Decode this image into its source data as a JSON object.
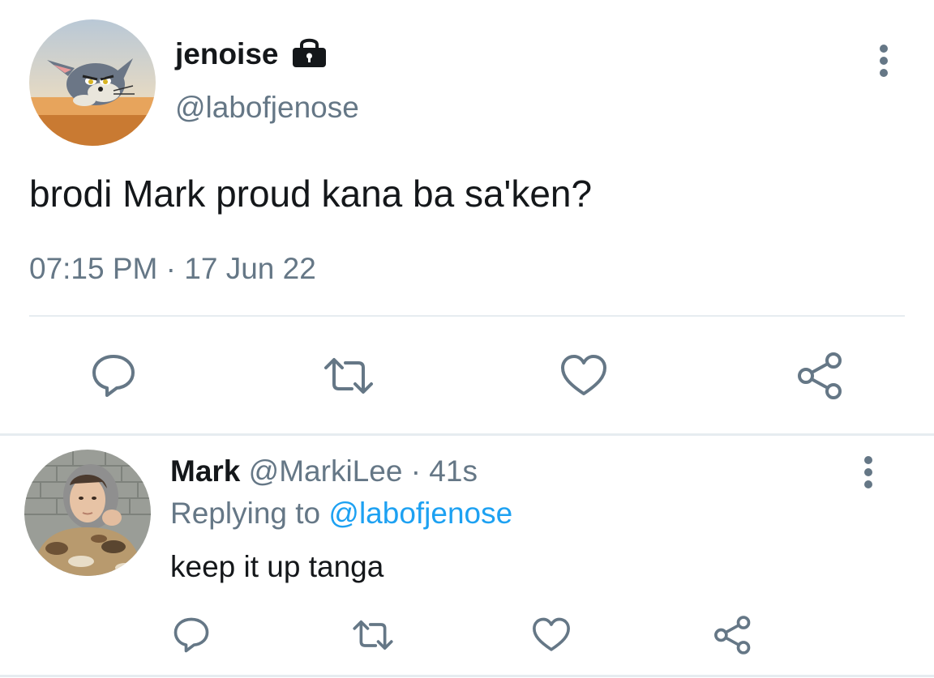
{
  "tweet": {
    "author": {
      "display_name": "jenoise",
      "handle": "@labofjenose",
      "avatar": "cartoon-cat-avatar",
      "protected_icon": "lock-icon"
    },
    "text": "brodi Mark proud kana ba sa'ken?",
    "time": "07:15 PM",
    "separator": "·",
    "date": "17 Jun 22",
    "more_icon": "more-vertical-icon",
    "actions": [
      "reply-icon",
      "retweet-icon",
      "like-icon",
      "share-icon"
    ]
  },
  "reply": {
    "display_name": "Mark",
    "handle": "@MarkiLee",
    "separator": "·",
    "time": "41s",
    "replying_prefix": "Replying to ",
    "replying_to": "@labofjenose",
    "text": "keep it up tanga",
    "avatar": "person-photo-avatar",
    "more_icon": "more-vertical-icon",
    "actions": [
      "reply-icon",
      "retweet-icon",
      "like-icon",
      "share-icon"
    ]
  },
  "colors": {
    "primary_text": "#14171a",
    "secondary_text": "#657786",
    "link": "#1da1f2",
    "icon": "#657786",
    "divider": "#e6ecf0"
  }
}
